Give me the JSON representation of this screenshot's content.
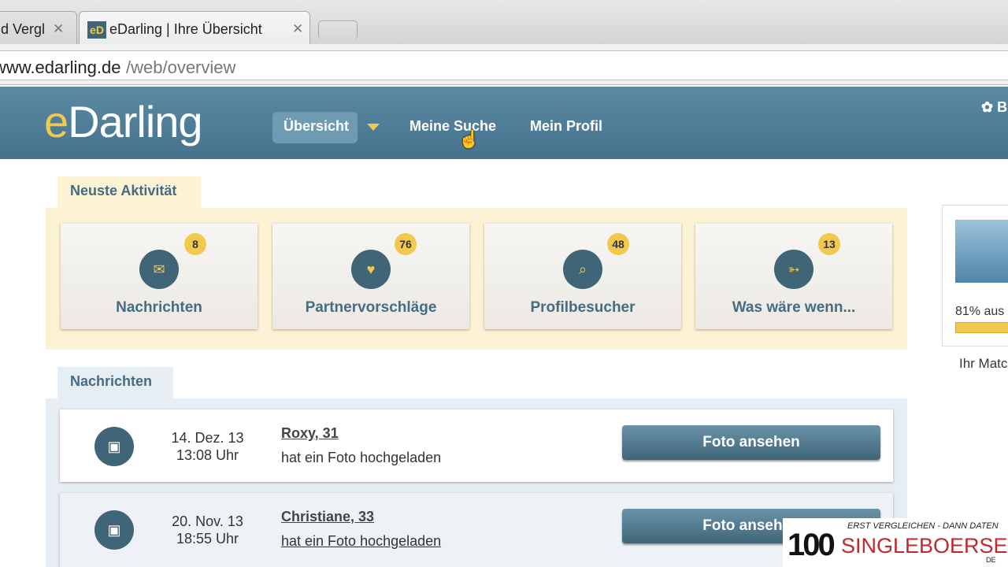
{
  "browser": {
    "tabs": [
      {
        "title": "d Vergl",
        "close": "✕"
      },
      {
        "title": "eDarling | Ihre Übersicht",
        "close": "✕",
        "favicon": "eD"
      }
    ],
    "url_host": "www.edarling.de",
    "url_path": "/web/overview"
  },
  "header": {
    "logo_e": "e",
    "logo_rest": "Darling",
    "nav": [
      "Übersicht",
      "Meine Suche",
      "Mein Profil"
    ],
    "settings_label": "B"
  },
  "activity": {
    "title": "Neuste Aktivität",
    "cards": [
      {
        "label": "Nachrichten",
        "count": "8",
        "icon": "envelope-icon"
      },
      {
        "label": "Partnervorschläge",
        "count": "76",
        "icon": "heart-icon"
      },
      {
        "label": "Profilbesucher",
        "count": "48",
        "icon": "magnifier-icon"
      },
      {
        "label": "Was wäre wenn...",
        "count": "13",
        "icon": "arrow-icon"
      }
    ]
  },
  "messages": {
    "title": "Nachrichten",
    "rows": [
      {
        "date": "14. Dez. 13",
        "time": "13:08 Uhr",
        "name": "Roxy, 31",
        "text": "hat ein Foto hochgeladen",
        "button": "Foto ansehen"
      },
      {
        "date": "20. Nov. 13",
        "time": "18:55 Uhr",
        "name": "Christiane, 33",
        "text": "hat ein Foto hochgeladen",
        "button": "Foto ansehen"
      }
    ]
  },
  "profile": {
    "percent_text": "81% aus",
    "match_text": "Ihr Matc"
  },
  "watermark": {
    "tagline": "ERST VERGLEICHEN - DANN DATEN",
    "number": "100",
    "name": "SINGLEBOERSEN",
    "suffix": "DE"
  },
  "colors": {
    "brand_blue": "#4f7f98",
    "accent_yellow": "#f2c94c"
  }
}
